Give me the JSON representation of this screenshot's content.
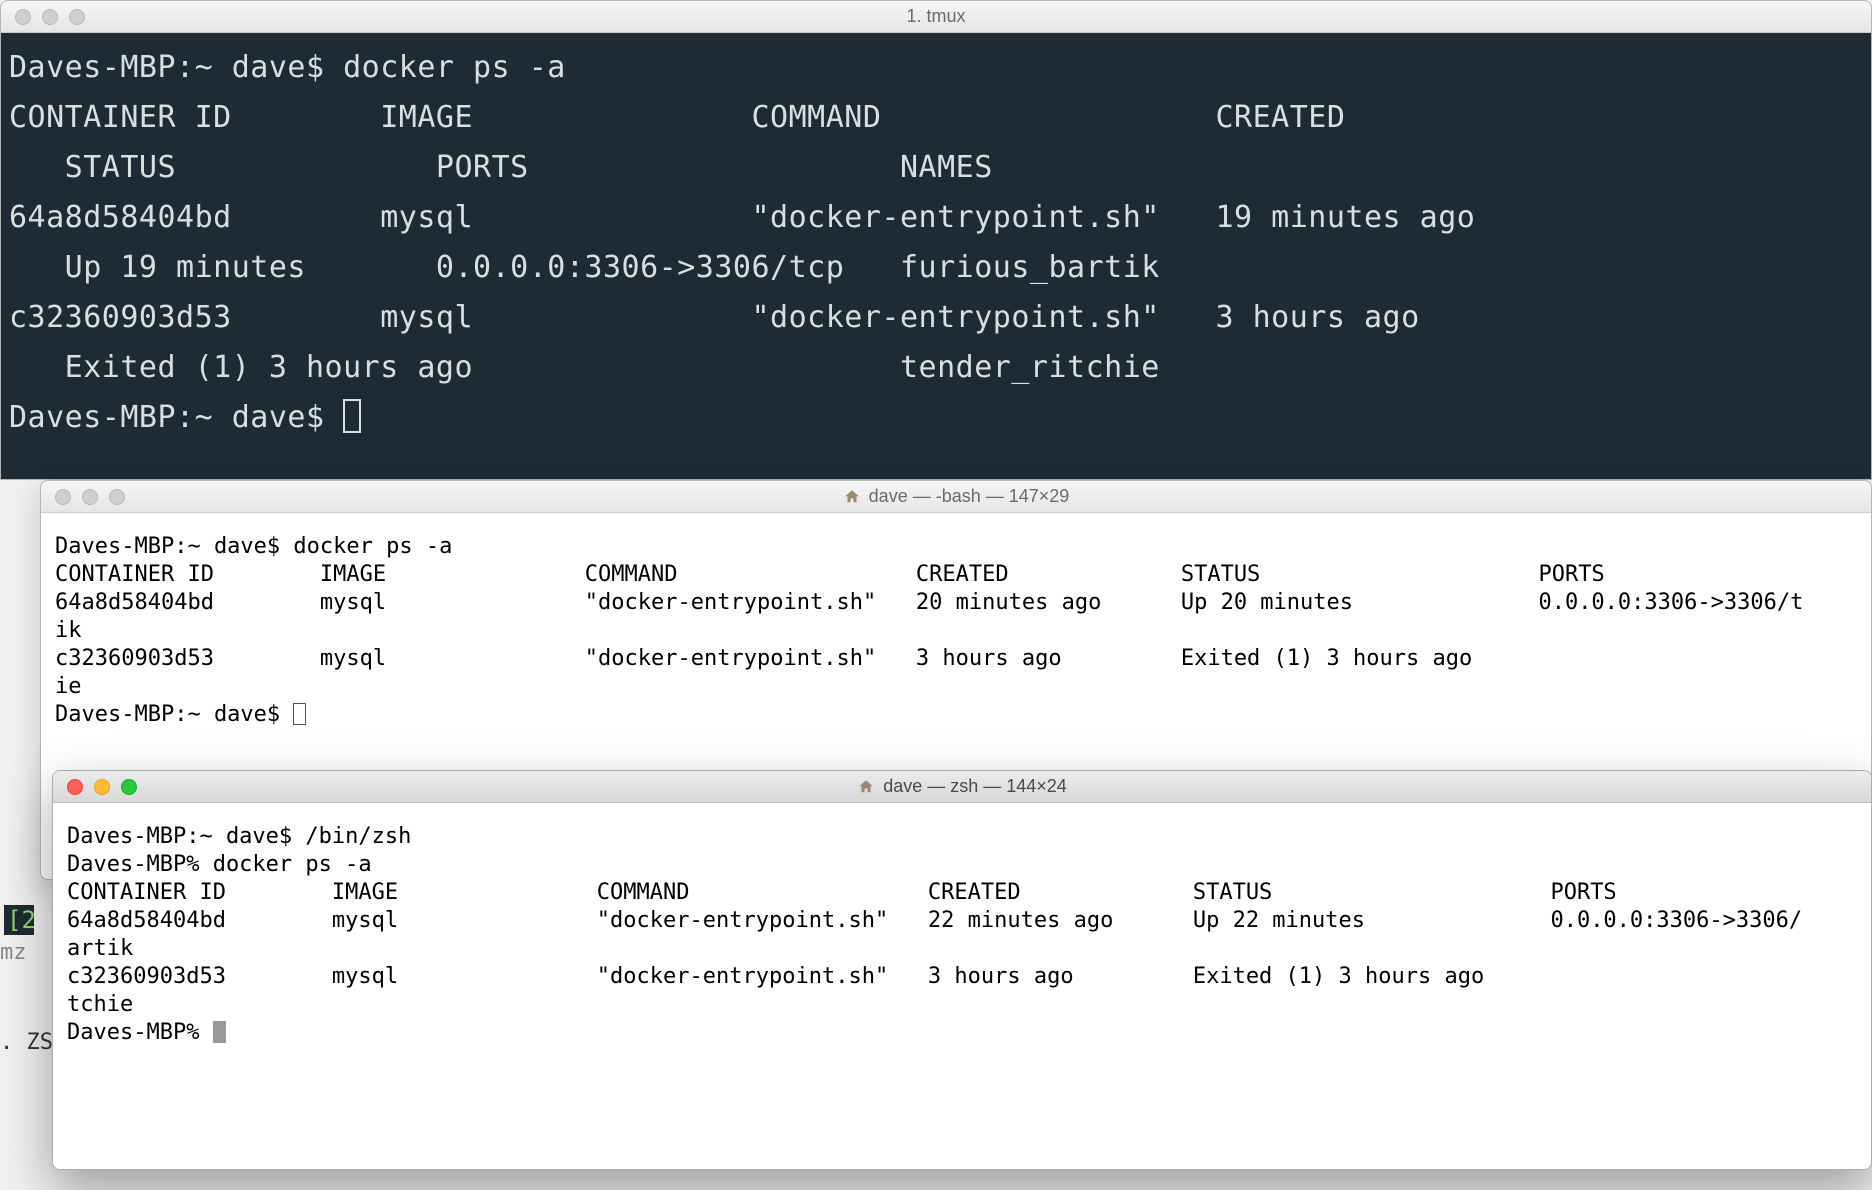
{
  "window1": {
    "title": "1. tmux",
    "prompt1": "Daves-MBP:~ dave$ docker ps -a",
    "header1": "CONTAINER ID        IMAGE               COMMAND                  CREATED",
    "header2": "   STATUS              PORTS                    NAMES",
    "row1a": "64a8d58404bd        mysql               \"docker-entrypoint.sh\"   19 minutes ago",
    "row1b": "   Up 19 minutes       0.0.0.0:3306->3306/tcp   furious_bartik",
    "row2a": "c32360903d53        mysql               \"docker-entrypoint.sh\"   3 hours ago",
    "row2b": "   Exited (1) 3 hours ago                       tender_ritchie",
    "prompt2": "Daves-MBP:~ dave$ "
  },
  "window2": {
    "title": "dave — -bash — 147×29",
    "prompt1": "Daves-MBP:~ dave$ docker ps -a",
    "header": "CONTAINER ID        IMAGE               COMMAND                  CREATED             STATUS                     PORTS",
    "row1": "64a8d58404bd        mysql               \"docker-entrypoint.sh\"   20 minutes ago      Up 20 minutes              0.0.0.0:3306->3306/t",
    "wrap1": "ik",
    "row2": "c32360903d53        mysql               \"docker-entrypoint.sh\"   3 hours ago         Exited (1) 3 hours ago",
    "wrap2": "ie",
    "prompt2": "Daves-MBP:~ dave$ "
  },
  "window3": {
    "title": "dave — zsh — 144×24",
    "line1": "Daves-MBP:~ dave$ /bin/zsh",
    "line2": "Daves-MBP% docker ps -a",
    "header": "CONTAINER ID        IMAGE               COMMAND                  CREATED             STATUS                     PORTS",
    "row1": "64a8d58404bd        mysql               \"docker-entrypoint.sh\"   22 minutes ago      Up 22 minutes              0.0.0.0:3306->3306/",
    "wrap1": "artik",
    "row2": "c32360903d53        mysql               \"docker-entrypoint.sh\"   3 hours ago         Exited (1) 3 hours ago",
    "wrap2": "tchie",
    "prompt": "Daves-MBP% "
  },
  "peek": {
    "p1": "[2",
    "p2": ". ZS",
    "p3": "mz"
  }
}
